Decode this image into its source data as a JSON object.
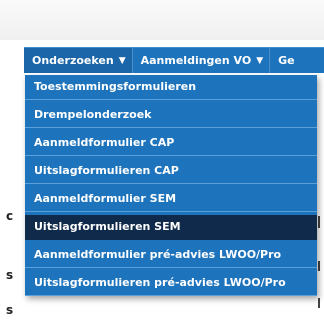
{
  "nav": {
    "items": [
      {
        "label": "Onderzoeken",
        "caret": "▼"
      },
      {
        "label": "Aanmeldingen VO",
        "caret": "▼"
      },
      {
        "label": "Ge"
      }
    ]
  },
  "dropdown": {
    "items": [
      {
        "label": "Toestemmingsformulieren"
      },
      {
        "label": "Drempelonderzoek"
      },
      {
        "label": "Aanmeldformulier CAP"
      },
      {
        "label": "Uitslagformulieren CAP"
      },
      {
        "label": "Aanmeldformulier SEM"
      },
      {
        "label": "Uitslagformulieren SEM",
        "active": true
      },
      {
        "label": "Aanmeldformulier pré-advies LWOO/Pro"
      },
      {
        "label": "Uitslagformulieren pré-advies LWOO/Pro"
      }
    ]
  },
  "background_fragments": {
    "char_left_1": "c",
    "char_left_2": "s",
    "char_left_3": "s"
  }
}
